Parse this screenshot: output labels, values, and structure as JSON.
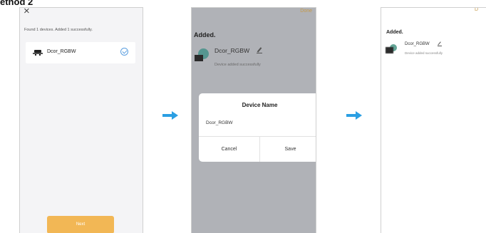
{
  "heading": "ethod 2",
  "step1": {
    "close_glyph": "×",
    "found_text": "Found 1 devices. Added 1 successfully.",
    "device_name": "Dcor_RGBW",
    "device_icon": "lamp-icon",
    "selected_icon": "check-circle-icon",
    "next_label": "Next",
    "accent_color": "#f2b755"
  },
  "step2": {
    "done_label": "Done",
    "added_title": "Added.",
    "device_name": "Dcor_RGBW",
    "device_status": "Device added successfully",
    "dialog": {
      "title": "Device Name",
      "value": "Dcor_RGBW",
      "cancel_label": "Cancel",
      "save_label": "Save"
    }
  },
  "step3": {
    "done_label": "D",
    "added_title": "Added.",
    "device_name": "Dcor_RGBW",
    "device_status": "Device added successfully"
  },
  "arrow_color": "#2b9fe3"
}
